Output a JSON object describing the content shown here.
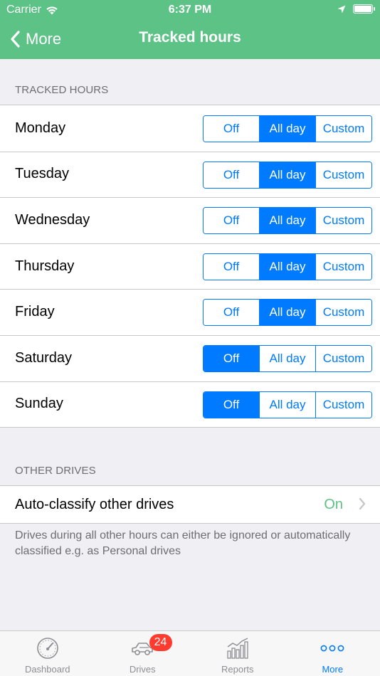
{
  "status_bar": {
    "carrier": "Carrier",
    "time": "6:37 PM"
  },
  "navbar": {
    "back_label": "More",
    "title": "Tracked hours"
  },
  "colors": {
    "brand_green": "#5cc285",
    "accent_blue": "#007aff",
    "badge_red": "#ff3b30"
  },
  "tracked_hours": {
    "section_header": "TRACKED HOURS",
    "options": [
      "Off",
      "All day",
      "Custom"
    ],
    "days": [
      {
        "label": "Monday",
        "selected": "All day"
      },
      {
        "label": "Tuesday",
        "selected": "All day"
      },
      {
        "label": "Wednesday",
        "selected": "All day"
      },
      {
        "label": "Thursday",
        "selected": "All day"
      },
      {
        "label": "Friday",
        "selected": "All day"
      },
      {
        "label": "Saturday",
        "selected": "Off"
      },
      {
        "label": "Sunday",
        "selected": "Off"
      }
    ]
  },
  "other_drives": {
    "section_header": "OTHER DRIVES",
    "auto_classify_label": "Auto-classify other drives",
    "auto_classify_value": "On",
    "note": "Drives during all other hours can either be ignored or automatically classified e.g. as Personal drives"
  },
  "tabbar": {
    "tabs": [
      {
        "label": "Dashboard",
        "icon": "speedometer-icon",
        "active": false
      },
      {
        "label": "Drives",
        "icon": "car-icon",
        "active": false,
        "badge": "24"
      },
      {
        "label": "Reports",
        "icon": "bar-chart-icon",
        "active": false
      },
      {
        "label": "More",
        "icon": "more-dots-icon",
        "active": true
      }
    ]
  }
}
